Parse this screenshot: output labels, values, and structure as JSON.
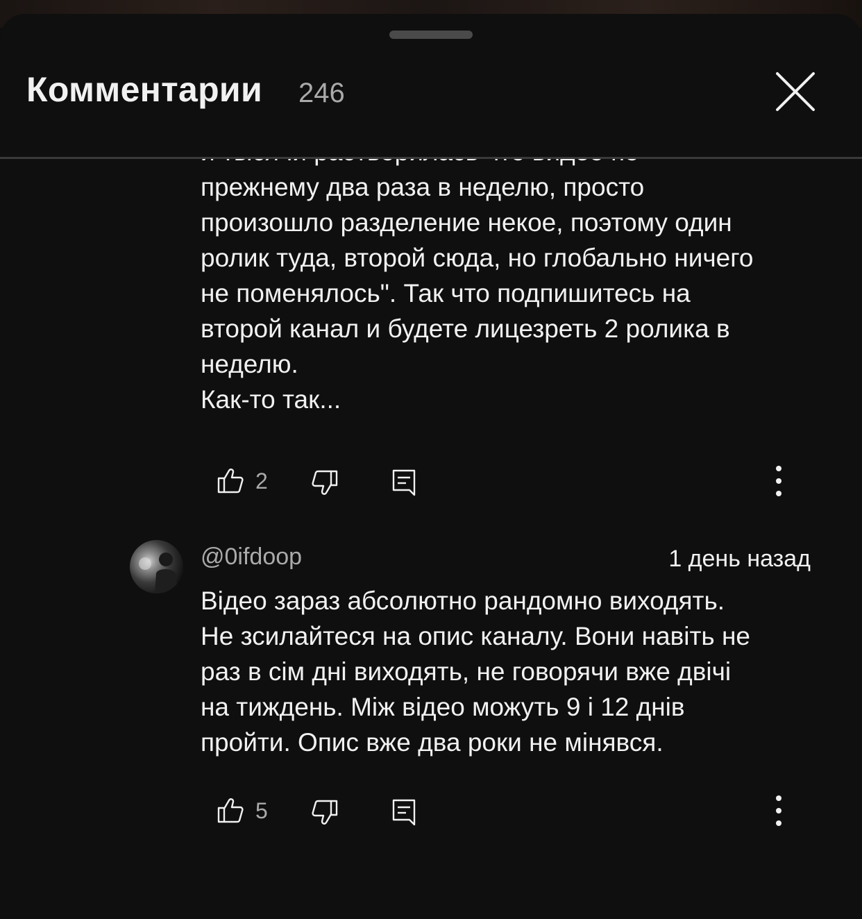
{
  "header": {
    "title": "Комментарии",
    "count": "246"
  },
  "comments": [
    {
      "partial_top_line": "и тысячи растворилась что видео по",
      "lines": [
        "прежнему два раза в неделю, просто",
        "произошло разделение некое, поэтому один",
        "ролик туда, второй сюда, но глобально ничего",
        "не поменялось\". Так что подпишитесь на",
        "второй канал и будете лицезреть 2 ролика в",
        "неделю.",
        "Как-то так..."
      ],
      "likes": "2"
    },
    {
      "author": "@0ifdoop",
      "time": "1 день назад",
      "lines": [
        "Відео зараз абсолютно рандомно виходять.",
        "Не зсилайтеся на опис каналу. Вони навіть не",
        "раз в сім дні виходять, не говорячи вже двічі",
        "на тиждень. Між відео можуть 9 і 12 днів",
        "пройти. Опис вже два роки не мінявся."
      ],
      "likes": "5"
    }
  ],
  "icons": {
    "like": "thumbs-up-icon",
    "dislike": "thumbs-down-icon",
    "reply": "reply-icon",
    "more": "more-vert-icon",
    "close": "close-icon"
  },
  "colors": {
    "background": "#0f0f0f",
    "text": "#f1f1f1",
    "secondary": "#aaaaaa",
    "divider": "#3a3a3a"
  }
}
